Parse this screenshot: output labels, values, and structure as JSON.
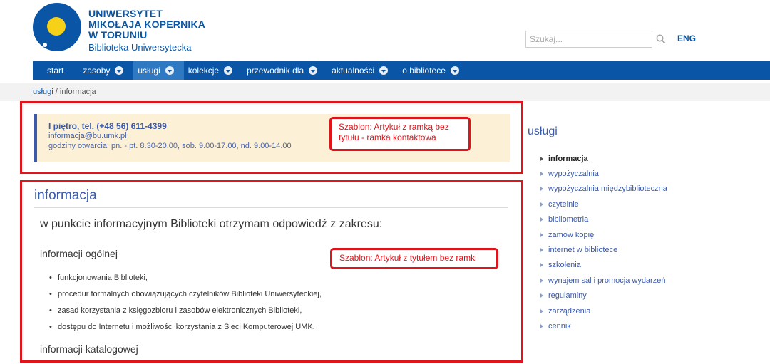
{
  "header": {
    "logo_lines": [
      "UNIWERSYTET",
      "MIKOŁAJA KOPERNIKA",
      "W TORUNIU"
    ],
    "logo_subtitle": "Biblioteka Uniwersytecka",
    "search_placeholder": "Szukaj...",
    "lang_label": "ENG",
    "icons": {
      "search": "search-icon",
      "logo": "university-logo"
    },
    "colors": {
      "brand_blue": "#0a55a5",
      "logo_sun": "#f7d117"
    }
  },
  "nav": {
    "items": [
      {
        "label": "start",
        "dropdown": false,
        "active": false
      },
      {
        "label": "zasoby",
        "dropdown": true,
        "active": false
      },
      {
        "label": "usługi",
        "dropdown": true,
        "active": true
      },
      {
        "label": "kolekcje",
        "dropdown": true,
        "active": false
      },
      {
        "label": "przewodnik dla",
        "dropdown": true,
        "active": false
      },
      {
        "label": "aktualności",
        "dropdown": true,
        "active": false
      },
      {
        "label": "o bibliotece",
        "dropdown": true,
        "active": false
      }
    ]
  },
  "breadcrumb": {
    "parent": "usługi",
    "separator": " / ",
    "current": "informacja"
  },
  "contact": {
    "phone": "I piętro, tel. (+48 56) 611-4399",
    "email": "informacja@bu.umk.pl",
    "hours": "godziny otwarcia: pn. - pt. 8.30-20.00, sob. 9.00-17.00, nd. 9.00-14.00",
    "colors": {
      "background": "#fcf1d6",
      "accent": "#3a5aab"
    }
  },
  "annotations": {
    "contact_tag": "Szablon: Artykuł z ramką bez tytułu - ramka kontaktowa",
    "article_tag": "Szablon: Artykuł z tytułem bez ramki",
    "color": "#e0141b"
  },
  "article": {
    "title": "informacja",
    "lead": "w punkcie informacyjnym Biblioteki otrzymam odpowiedź z zakresu:",
    "section1_heading": "informacji ogólnej",
    "bullets": [
      "funkcjonowania Biblioteki,",
      "procedur formalnych obowiązujących czytelników Biblioteki Uniwersyteckiej,",
      "zasad korzystania z księgozbioru i zasobów elektronicznych Biblioteki,",
      "dostępu do Internetu i możliwości korzystania z Sieci Komputerowej UMK."
    ],
    "section2_heading": "informacji katalogowej"
  },
  "sidebar": {
    "title": "usługi",
    "items": [
      {
        "label": "informacja",
        "active": true
      },
      {
        "label": "wypożyczalnia",
        "active": false
      },
      {
        "label": "wypożyczalnia międzybiblioteczna",
        "active": false
      },
      {
        "label": "czytelnie",
        "active": false
      },
      {
        "label": "bibliometria",
        "active": false
      },
      {
        "label": "zamów kopię",
        "active": false
      },
      {
        "label": "internet w bibliotece",
        "active": false
      },
      {
        "label": "szkolenia",
        "active": false
      },
      {
        "label": "wynajem sal i promocja wydarzeń",
        "active": false
      },
      {
        "label": "regulaminy",
        "active": false
      },
      {
        "label": "zarządzenia",
        "active": false
      },
      {
        "label": "cennik",
        "active": false
      }
    ]
  }
}
